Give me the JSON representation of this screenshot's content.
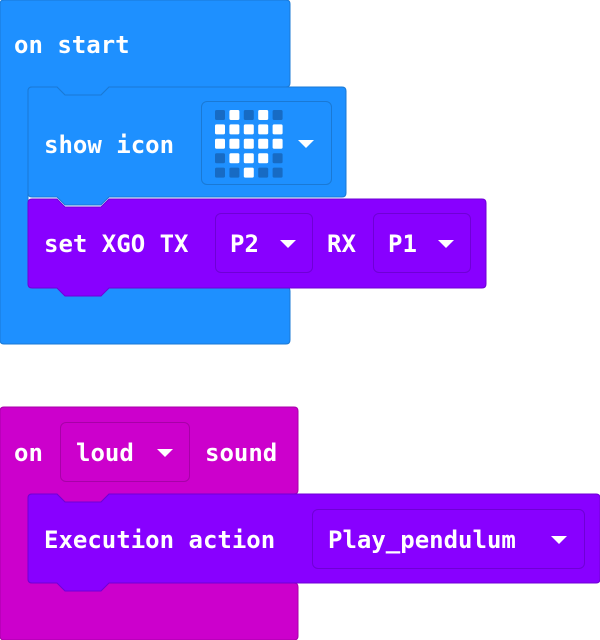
{
  "on_start": {
    "label": "on start",
    "show_icon": {
      "label": "show icon",
      "icon": "heart-icon"
    },
    "set_xgo": {
      "label": "set XGO TX",
      "tx_value": "P2",
      "rx_label": "RX",
      "rx_value": "P1"
    }
  },
  "on_sound": {
    "label_on": "on",
    "sound_value": "loud",
    "label_sound": "sound",
    "execution": {
      "label": "Execution action",
      "action_value": "Play_pendulum"
    }
  },
  "colors": {
    "basic": "#1e90ff",
    "basic_border": "#1a79d5",
    "xgo": "#8800ff",
    "xgo_border": "#6f00d6",
    "input": "#cc00cc",
    "input_border": "#a800a8"
  },
  "heart_grid": [
    [
      0,
      1,
      0,
      1,
      0
    ],
    [
      1,
      1,
      1,
      1,
      1
    ],
    [
      1,
      1,
      1,
      1,
      1
    ],
    [
      0,
      1,
      1,
      1,
      0
    ],
    [
      0,
      0,
      1,
      0,
      0
    ]
  ]
}
